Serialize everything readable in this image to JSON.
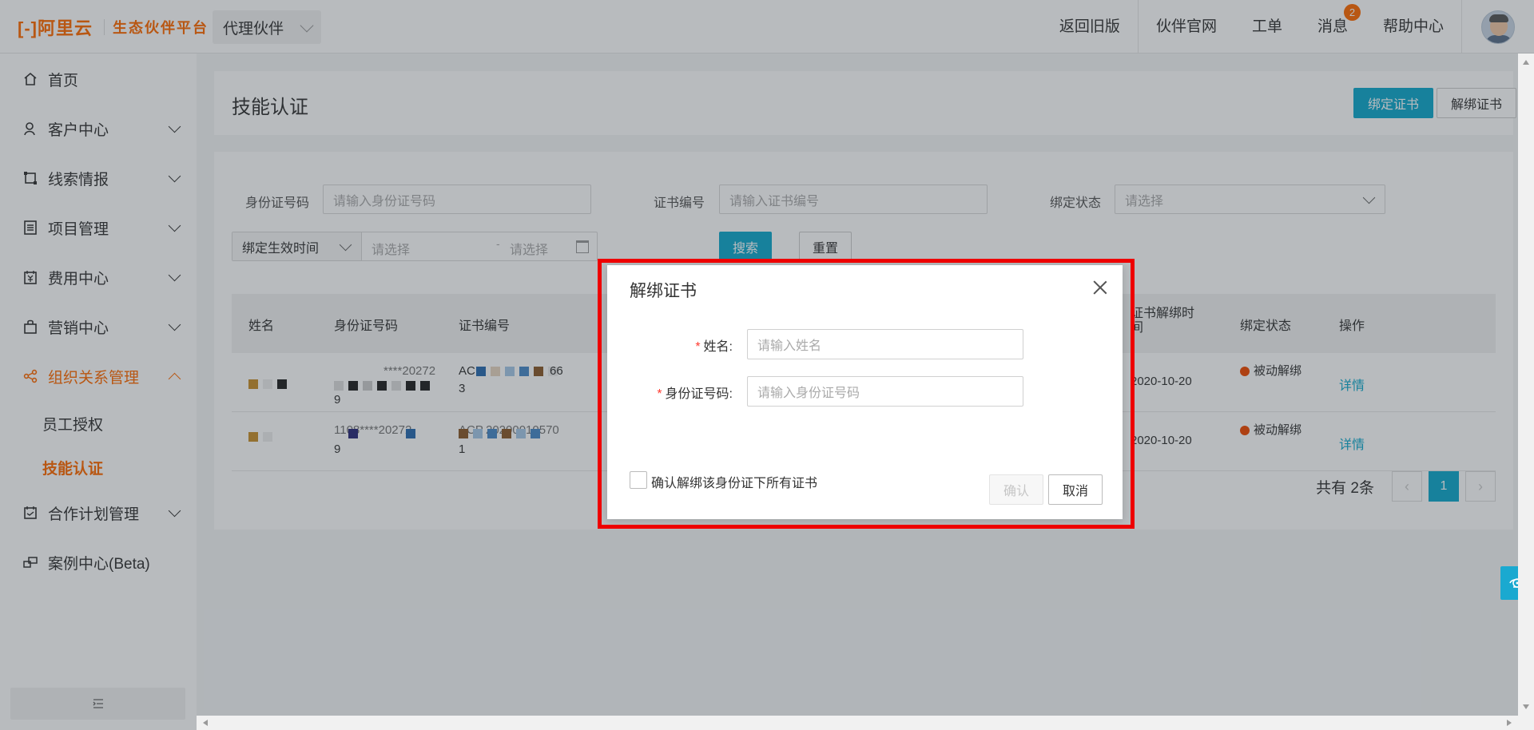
{
  "header": {
    "logo_text": "[-]阿里云",
    "platform": "生态伙伴平台",
    "role_select": "代理伙伴",
    "nav": [
      "返回旧版",
      "伙伴官网",
      "工单",
      "消息",
      "帮助中心"
    ],
    "message_badge": "2"
  },
  "sidebar": {
    "items": [
      {
        "label": "首页",
        "icon": "home-icon",
        "expandable": false
      },
      {
        "label": "客户中心",
        "icon": "customer-icon",
        "expandable": true
      },
      {
        "label": "线索情报",
        "icon": "leads-icon",
        "expandable": true
      },
      {
        "label": "项目管理",
        "icon": "project-icon",
        "expandable": true
      },
      {
        "label": "费用中心",
        "icon": "fee-icon",
        "expandable": true
      },
      {
        "label": "营销中心",
        "icon": "marketing-icon",
        "expandable": true
      },
      {
        "label": "组织关系管理",
        "icon": "share-icon",
        "expandable": true,
        "expanded": true,
        "active": true
      },
      {
        "label": "合作计划管理",
        "icon": "plan-icon",
        "expandable": true
      },
      {
        "label": "案例中心(Beta)",
        "icon": "case-icon",
        "expandable": false
      }
    ],
    "sub_items": [
      {
        "label": "员工授权",
        "active": false
      },
      {
        "label": "技能认证",
        "active": true
      }
    ]
  },
  "page": {
    "title": "技能认证",
    "bind_button": "绑定证书",
    "unbind_button": "解绑证书"
  },
  "filters": {
    "id_label": "身份证号码",
    "id_placeholder": "请输入身份证号码",
    "cert_label": "证书编号",
    "cert_placeholder": "请输入证书编号",
    "status_label": "绑定状态",
    "status_placeholder": "请选择",
    "date_type": "绑定生效时间",
    "date_start_placeholder": "请选择",
    "date_sep": "-",
    "date_end_placeholder": "请选择",
    "search_button": "搜索",
    "reset_button": "重置"
  },
  "table": {
    "columns": [
      "姓名",
      "身份证号码",
      "证书编号",
      "证书解绑时间",
      "绑定状态",
      "操作"
    ],
    "rows": [
      {
        "id_fragment": "****20272",
        "id_tail": "9",
        "cert_prefix": "ACE",
        "cert_frag": "66",
        "cert_tail": "3",
        "unbind_time": "2020-10-20",
        "status": "被动解绑",
        "action": "详情"
      },
      {
        "id_fragment": "1108****20272",
        "id_tail": "9",
        "cert_prefix": "ACP",
        "cert_frag": "20200010570",
        "cert_tail": "1",
        "unbind_time": "2020-10-20",
        "status": "被动解绑",
        "action": "详情"
      }
    ],
    "total_text": "共有 2条",
    "current_page": "1"
  },
  "modal": {
    "title": "解绑证书",
    "name_label": "姓名:",
    "name_placeholder": "请输入姓名",
    "id_label": "身份证号码:",
    "id_placeholder": "请输入身份证号码",
    "required_mark": "*",
    "confirm_all_label": "确认解绑该身份证下所有证书",
    "confirm_button": "确认",
    "cancel_button": "取消"
  },
  "colors": {
    "brand_orange": "#ff6a00",
    "primary_teal": "#0fa9cc",
    "highlight_red": "#ee0000",
    "status_red": "#f04a00"
  }
}
